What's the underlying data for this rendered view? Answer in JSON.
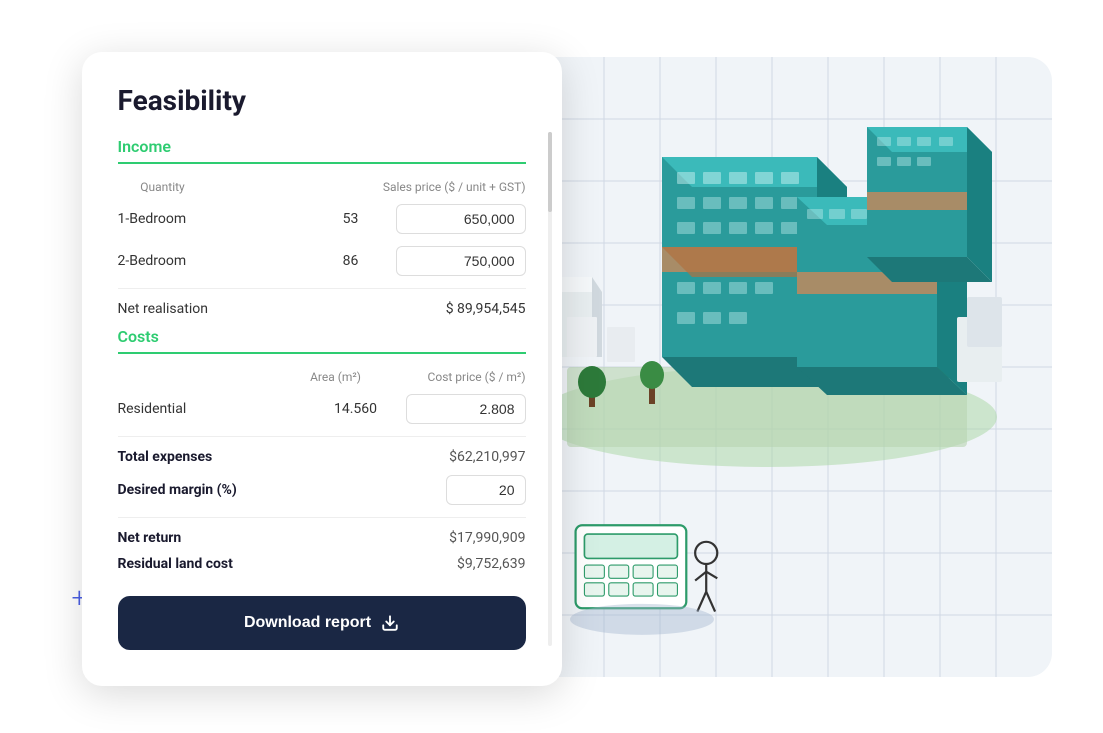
{
  "card": {
    "title": "Feasibility",
    "income_section": {
      "label": "Income",
      "table_headers": {
        "quantity": "Quantity",
        "sales_price": "Sales price ($ / unit + GST)"
      },
      "rows": [
        {
          "label": "1-Bedroom",
          "quantity": "53",
          "price": "650,000"
        },
        {
          "label": "2-Bedroom",
          "quantity": "86",
          "price": "750,000"
        }
      ],
      "net_realisation": {
        "label": "Net realisation",
        "value": "$ 89,954,545"
      }
    },
    "costs_section": {
      "label": "Costs",
      "table_headers": {
        "area": "Area (m²)",
        "cost_price": "Cost price ($ / m²)"
      },
      "rows": [
        {
          "label": "Residential",
          "area": "14.560",
          "cost_price": "2.808"
        }
      ],
      "total_expenses": {
        "label": "Total expenses",
        "value": "$62,210,997"
      },
      "desired_margin": {
        "label": "Desired margin (%)",
        "value": "20"
      },
      "net_return": {
        "label": "Net return",
        "value": "$17,990,909"
      },
      "residual_land_cost": {
        "label": "Residual land cost",
        "value": "$9,752,639"
      }
    },
    "download_button": {
      "label": "Download report"
    }
  },
  "decorators": {
    "plus_sign": "+",
    "yellow_dot": "●"
  }
}
